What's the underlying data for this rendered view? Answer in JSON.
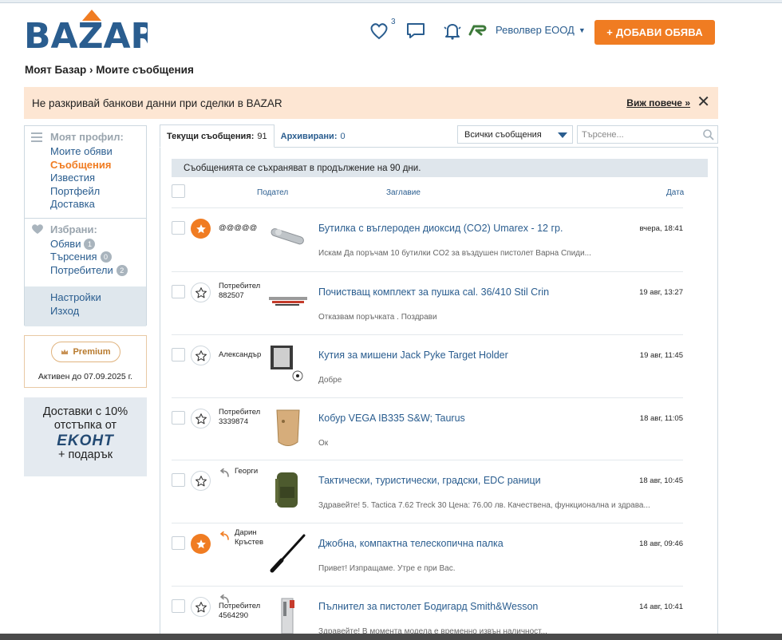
{
  "brand": {
    "logo_text": "BAZAR",
    "accent": "#f07c22",
    "link_color": "#2a5d8f"
  },
  "header": {
    "favorites_icon": "heart-icon",
    "favorites_count": "3",
    "messages_icon": "chat-bubble-icon",
    "notifications_icon": "bell-icon",
    "company_name": "Револвер ЕООД",
    "add_button": "+ ДОБАВИ ОБЯВА"
  },
  "breadcrumb": "Моят Базар › Моите съобщения",
  "notice": {
    "text": "Не разкривай банкови данни при сделки в BAZAR",
    "more": "Виж повече »"
  },
  "sidebar": {
    "profile_heading": "Моят профил:",
    "profile_links": [
      "Моите обяви",
      "Съобщения",
      "Известия",
      "Портфейл",
      "Доставка"
    ],
    "favorites_heading": "Избрани:",
    "favorites": [
      {
        "label": "Обяви",
        "count": "1"
      },
      {
        "label": "Търсения",
        "count": "0"
      },
      {
        "label": "Потребители",
        "count": "2"
      }
    ],
    "settings_links": [
      "Настройки",
      "Изход"
    ]
  },
  "premium": {
    "label": "Premium",
    "active_until": "Активен до 07.09.2025 г."
  },
  "econt": {
    "line1": "Доставки с 10%",
    "line2": "отстъпка от",
    "logo": "EKOHT",
    "line3": "+ подарък"
  },
  "tabs": [
    {
      "label": "Текущи съобщения:",
      "count": "91"
    },
    {
      "label": "Архивирани:",
      "count": "0"
    }
  ],
  "filter": {
    "selected": "Всички съобщения"
  },
  "search": {
    "placeholder": "Търсене..."
  },
  "info": "Съобщенията се съхраняват в продължение на 90 дни.",
  "columns": {
    "sender": "Подател",
    "title": "Заглавие",
    "date": "Дата"
  },
  "messages": [
    {
      "sender": "@@@@@",
      "sender2": "",
      "starred": true,
      "replied": false,
      "thumb": "co2-capsule",
      "title": "Бутилка с въглероден диоксид (CO2) Umarex - 12 гр.",
      "date": "вчера, 18:41",
      "preview": "Искам Да поръчам 10 бутилки CO2 за въздушен пистолет Варна Спиди..."
    },
    {
      "sender": "Потребител",
      "sender2": "882507",
      "starred": false,
      "replied": false,
      "thumb": "cleaning-kit",
      "title": "Почистващ комплект за пушка cal. 36/410 Stil Crin",
      "date": "19 авг, 13:27",
      "preview": "Отказвам поръчката . Поздрави"
    },
    {
      "sender": "Александър",
      "sender2": "",
      "starred": false,
      "replied": false,
      "thumb": "target-holder",
      "title": "Кутия за мишени Jack Pyke Target Holder",
      "date": "19 авг, 11:45",
      "preview": "Добре"
    },
    {
      "sender": "Потребител",
      "sender2": "3339874",
      "starred": false,
      "replied": false,
      "thumb": "holster",
      "title": "Кобур VEGA IB335 S&W; Taurus",
      "date": "18 авг, 11:05",
      "preview": "Ок"
    },
    {
      "sender": "Георги",
      "sender2": "",
      "starred": false,
      "replied": true,
      "thumb": "backpack",
      "title": "Тактически, туристически, градски, EDC раници",
      "date": "18 авг, 10:45",
      "preview": "Здравейте! 5. Tactica 7.62 Treck 30 Цена: 76.00 лв. Качествена, функционална и здрава..."
    },
    {
      "sender": "Дарин",
      "sender2": "Кръстев",
      "starred": true,
      "replied": true,
      "thumb": "baton",
      "title": "Джобна, компактна телескопична палка",
      "date": "18 авг, 09:46",
      "preview": "Привет! Изпращаме. Утре е при Вас."
    },
    {
      "sender": "Потребител",
      "sender2": "4564290",
      "starred": false,
      "replied": true,
      "thumb": "magazine",
      "title": "Пълнител за пистолет Бодигард Smith&Wesson",
      "date": "14 авг, 10:41",
      "preview": "Здравейте! В момента модела е временно извън наличност..."
    }
  ]
}
